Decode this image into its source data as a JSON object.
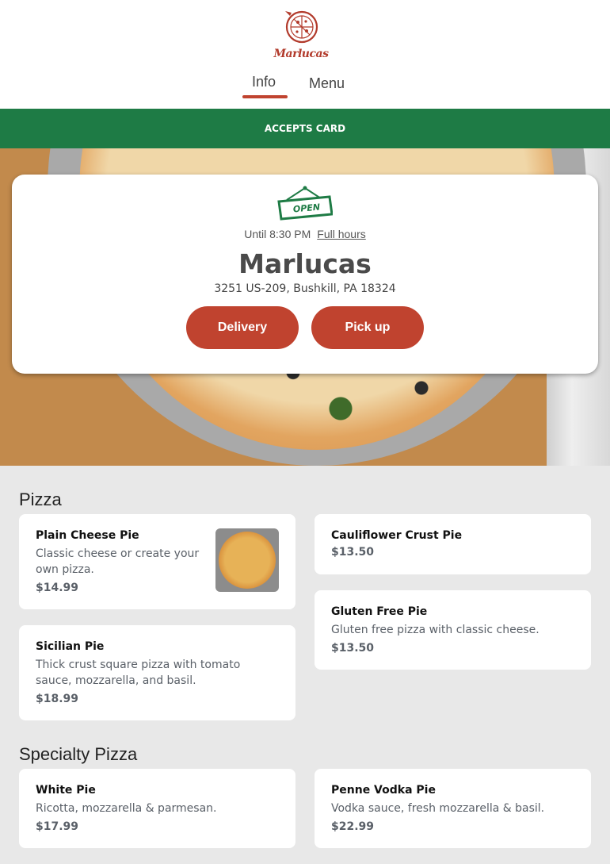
{
  "header": {
    "logo_text": "Marlucas",
    "tabs": [
      {
        "label": "Info",
        "active": true
      },
      {
        "label": "Menu",
        "active": false
      }
    ]
  },
  "banner": {
    "text": "ACCEPTS CARD"
  },
  "hero_card": {
    "open_sign": "OPEN",
    "hours_text": "Until 8:30 PM",
    "full_hours_link": "Full hours",
    "restaurant_name": "Marlucas",
    "address": "3251 US-209, Bushkill, PA 18324",
    "delivery_button": "Delivery",
    "pickup_button": "Pick up"
  },
  "sections": [
    {
      "title": "Pizza",
      "items": [
        {
          "name": "Plain Cheese Pie",
          "description": "Classic cheese or create your own pizza.",
          "price": "$14.99",
          "has_image": true
        },
        {
          "name": "Cauliflower Crust Pie",
          "description": "",
          "price": "$13.50"
        },
        {
          "name": "Sicilian Pie",
          "description": "Thick crust square pizza with tomato sauce, mozzarella, and basil.",
          "price": "$18.99"
        },
        {
          "name": "Gluten Free Pie",
          "description": "Gluten free pizza with classic cheese.",
          "price": "$13.50"
        }
      ]
    },
    {
      "title": "Specialty Pizza",
      "items": [
        {
          "name": "White Pie",
          "description": "Ricotta, mozzarella & parmesan.",
          "price": "$17.99"
        },
        {
          "name": "Penne Vodka Pie",
          "description": "Vodka sauce, fresh mozzarella & basil.",
          "price": "$22.99"
        }
      ]
    }
  ],
  "colors": {
    "brand_red": "#c0432f",
    "banner_green": "#1e7b45",
    "background": "#e8e8e8"
  }
}
